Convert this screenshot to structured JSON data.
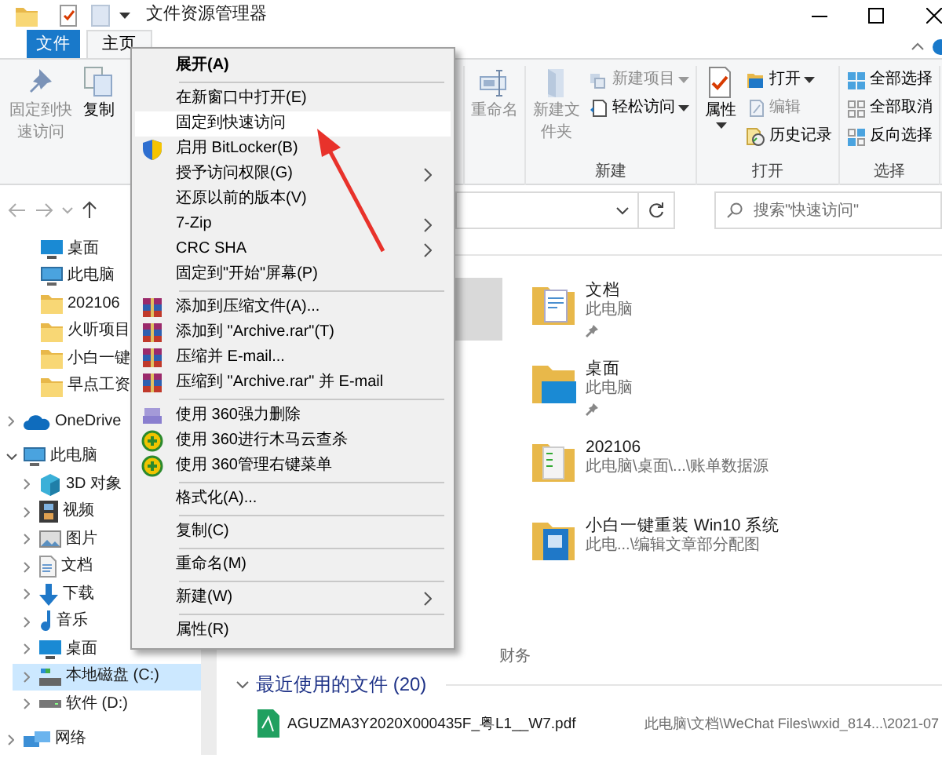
{
  "window": {
    "title": "文件资源管理器"
  },
  "ribbon": {
    "tabs": [
      {
        "label": "文件",
        "kind": "file",
        "selected": false
      },
      {
        "label": "主页",
        "kind": "tab",
        "selected": true
      }
    ],
    "groups": [
      {
        "buttons": [
          {
            "label": "固定到快速访问",
            "kind": "large",
            "disabled": true,
            "dropdown": false
          },
          {
            "label": "复制",
            "kind": "large",
            "disabled": false,
            "dropdown": false
          }
        ]
      },
      {
        "buttons": [
          {
            "label": "重命名",
            "kind": "large",
            "disabled": true,
            "dropdown": false
          }
        ]
      },
      {
        "label": "新建",
        "buttons": [
          {
            "label": "新建文件夹",
            "kind": "large",
            "disabled": true,
            "dropdown": false
          },
          {
            "label": "新建项目",
            "kind": "small",
            "disabled": true,
            "dropdown": true
          },
          {
            "label": "轻松访问",
            "kind": "small",
            "disabled": false,
            "dropdown": true
          }
        ]
      },
      {
        "label": "打开",
        "buttons": [
          {
            "label": "属性",
            "kind": "large",
            "disabled": false,
            "dropdown": true
          },
          {
            "label": "打开",
            "kind": "small",
            "disabled": false,
            "dropdown": true
          },
          {
            "label": "编辑",
            "kind": "small",
            "disabled": true,
            "dropdown": false
          },
          {
            "label": "历史记录",
            "kind": "small",
            "disabled": false,
            "dropdown": false
          }
        ]
      },
      {
        "label": "选择",
        "buttons": [
          {
            "label": "全部选择",
            "kind": "small",
            "disabled": false,
            "dropdown": false
          },
          {
            "label": "全部取消",
            "kind": "small",
            "disabled": false,
            "dropdown": false
          },
          {
            "label": "反向选择",
            "kind": "small",
            "disabled": false,
            "dropdown": false
          }
        ]
      }
    ]
  },
  "search": {
    "placeholder": "搜索\"快速访问\""
  },
  "sidebar": {
    "quick_items": [
      {
        "label": "桌面",
        "kind": "desktop"
      },
      {
        "label": "此电脑",
        "kind": "pc"
      },
      {
        "label": "202106",
        "kind": "folder"
      },
      {
        "label": "火听项目",
        "kind": "folder"
      },
      {
        "label": "小白一键",
        "kind": "folder"
      },
      {
        "label": "早点工资",
        "kind": "folder"
      }
    ],
    "tree": [
      {
        "label": "OneDrive",
        "kind": "cloud",
        "expanded": false,
        "selected": false
      },
      {
        "label": "此电脑",
        "kind": "pc",
        "expanded": true,
        "selected": false,
        "children": [
          {
            "label": "3D 对象",
            "kind": "cube",
            "expanded": false,
            "selected": false
          },
          {
            "label": "视频",
            "kind": "video",
            "expanded": false,
            "selected": false
          },
          {
            "label": "图片",
            "kind": "picture",
            "expanded": false,
            "selected": false
          },
          {
            "label": "文档",
            "kind": "doc",
            "expanded": false,
            "selected": false
          },
          {
            "label": "下载",
            "kind": "download",
            "expanded": false,
            "selected": false
          },
          {
            "label": "音乐",
            "kind": "music",
            "expanded": false,
            "selected": false
          },
          {
            "label": "桌面",
            "kind": "desktop",
            "expanded": false,
            "selected": false
          },
          {
            "label": "本地磁盘 (C:)",
            "kind": "drive-c",
            "expanded": false,
            "selected": true
          },
          {
            "label": "软件 (D:)",
            "kind": "drive",
            "expanded": false,
            "selected": false
          }
        ]
      },
      {
        "label": "网络",
        "kind": "network",
        "expanded": false,
        "selected": false
      }
    ]
  },
  "quick_access": [
    {
      "name": "文档",
      "location": "此电脑",
      "kind": "docs",
      "pinned": true
    },
    {
      "name": "桌面",
      "location": "此电脑",
      "kind": "desktop",
      "pinned": true
    },
    {
      "name": "202106",
      "location": "此电脑\\桌面\\...\\账单数据源",
      "kind": "sheets",
      "pinned": false
    },
    {
      "name": "小白一键重装 Win10 系统",
      "location": "此电...\\编辑文章部分配图",
      "kind": "blue",
      "pinned": false
    }
  ],
  "partial_text": "财务",
  "recent": {
    "title": "最近使用的文件 (20)",
    "expanded": true,
    "files": [
      {
        "name": "AGUZMA3Y2020X000435F_粤L1__W7.pdf",
        "path": "此电脑\\文档\\WeChat Files\\wxid_814...\\2021-07"
      }
    ]
  },
  "context_menu": {
    "groups": [
      [
        {
          "label": "展开(A)",
          "kind": "text",
          "default": true,
          "selected": false,
          "submenu": false
        }
      ],
      [
        {
          "label": "在新窗口中打开(E)",
          "kind": "text",
          "default": false,
          "selected": false,
          "submenu": false
        },
        {
          "label": "固定到快速访问",
          "kind": "text",
          "default": false,
          "selected": true,
          "submenu": false
        },
        {
          "label": "启用 BitLocker(B)",
          "kind": "shield",
          "default": false,
          "selected": false,
          "submenu": false
        },
        {
          "label": "授予访问权限(G)",
          "kind": "text",
          "default": false,
          "selected": false,
          "submenu": true
        },
        {
          "label": "还原以前的版本(V)",
          "kind": "text",
          "default": false,
          "selected": false,
          "submenu": false
        },
        {
          "label": "7-Zip",
          "kind": "text",
          "default": false,
          "selected": false,
          "submenu": true
        },
        {
          "label": "CRC SHA",
          "kind": "text",
          "default": false,
          "selected": false,
          "submenu": true
        },
        {
          "label": "固定到\"开始\"屏幕(P)",
          "kind": "text",
          "default": false,
          "selected": false,
          "submenu": false
        }
      ],
      [
        {
          "label": "添加到压缩文件(A)...",
          "kind": "archive",
          "default": false,
          "selected": false,
          "submenu": false
        },
        {
          "label": "添加到 \"Archive.rar\"(T)",
          "kind": "archive",
          "default": false,
          "selected": false,
          "submenu": false
        },
        {
          "label": "压缩并 E-mail...",
          "kind": "archive",
          "default": false,
          "selected": false,
          "submenu": false
        },
        {
          "label": "压缩到 \"Archive.rar\" 并 E-mail",
          "kind": "archive",
          "default": false,
          "selected": false,
          "submenu": false
        }
      ],
      [
        {
          "label": "使用 360强力删除",
          "kind": "shredder",
          "default": false,
          "selected": false,
          "submenu": false
        },
        {
          "label": "使用 360进行木马云查杀",
          "kind": "guard",
          "default": false,
          "selected": false,
          "submenu": false
        },
        {
          "label": "使用 360管理右键菜单",
          "kind": "guard",
          "default": false,
          "selected": false,
          "submenu": false
        }
      ],
      [
        {
          "label": "格式化(A)...",
          "kind": "text",
          "default": false,
          "selected": false,
          "submenu": false
        }
      ],
      [
        {
          "label": "复制(C)",
          "kind": "text",
          "default": false,
          "selected": false,
          "submenu": false
        }
      ],
      [
        {
          "label": "重命名(M)",
          "kind": "text",
          "default": false,
          "selected": false,
          "submenu": false
        }
      ],
      [
        {
          "label": "新建(W)",
          "kind": "text",
          "default": false,
          "selected": false,
          "submenu": true
        }
      ],
      [
        {
          "label": "属性(R)",
          "kind": "text",
          "default": false,
          "selected": false,
          "submenu": false
        }
      ]
    ]
  }
}
